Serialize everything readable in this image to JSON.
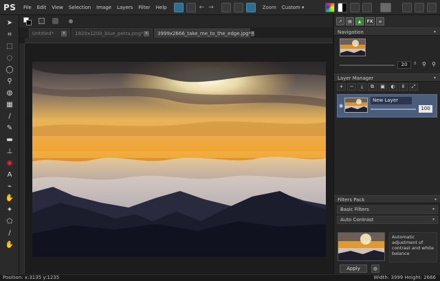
{
  "app": {
    "logo": "PS"
  },
  "menu": [
    "File",
    "Edit",
    "View",
    "Selection",
    "Image",
    "Layers",
    "Filter",
    "Help"
  ],
  "zoom": {
    "label": "Zoom",
    "value": "Custom"
  },
  "tabs": [
    {
      "label": "Untitled*",
      "active": false
    },
    {
      "label": "1920x1200_blue_petra.png*",
      "active": false
    },
    {
      "label": "3999x2666_take_me_to_the_edge.jpg*",
      "active": true
    }
  ],
  "panels": {
    "navigation": {
      "title": "Navigation",
      "zoom_value": "20"
    },
    "layers": {
      "title": "Layer Manager",
      "items": [
        {
          "name": "New Layer",
          "opacity": "100"
        }
      ]
    },
    "filters": {
      "title": "Filters Pack",
      "category": "Basic Filters",
      "selected": "Auto Contrast",
      "description": "Automatic adjustment of contrast and white balance",
      "apply_label": "Apply"
    }
  },
  "status": {
    "position": "Position: x:3135 y:1235",
    "size": "Width: 3999 Height: 2666"
  },
  "colors": {
    "accent_blue": "#2e6f8f",
    "layer_highlight": "#4a5d7a",
    "panel_bg": "#262626"
  }
}
